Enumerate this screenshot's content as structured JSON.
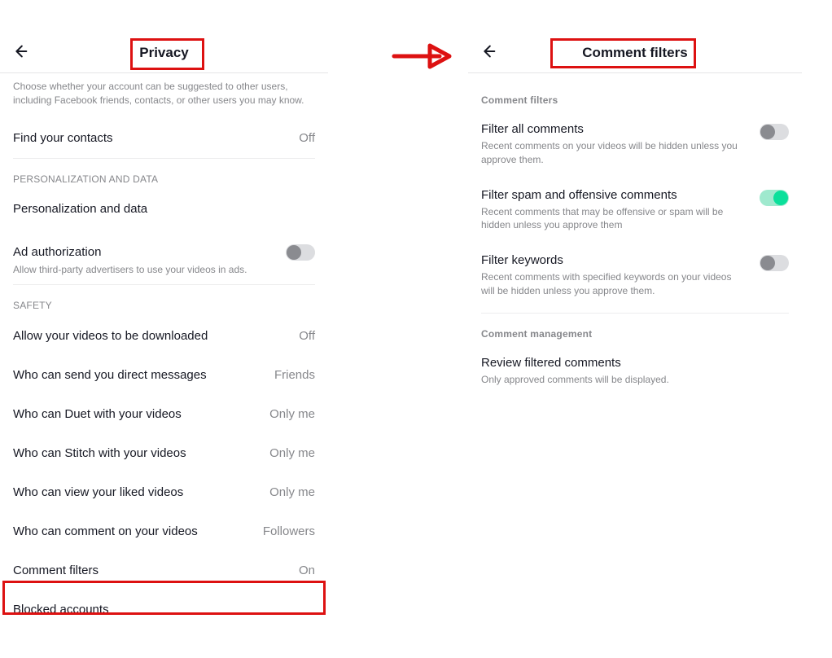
{
  "left": {
    "title": "Privacy",
    "helper": "Choose whether your account can be suggested to other users, including Facebook friends, contacts, or other users you may know.",
    "find_contacts": {
      "label": "Find your contacts",
      "value": "Off"
    },
    "section_personalization": "PERSONALIZATION AND DATA",
    "personalization": {
      "label": "Personalization and data"
    },
    "ad_auth": {
      "label": "Ad authorization",
      "desc": "Allow third-party advertisers to use your videos in ads."
    },
    "section_safety": "SAFETY",
    "safety": [
      {
        "label": "Allow your videos to be downloaded",
        "value": "Off"
      },
      {
        "label": "Who can send you direct messages",
        "value": "Friends"
      },
      {
        "label": "Who can Duet with your videos",
        "value": "Only me"
      },
      {
        "label": "Who can Stitch with your videos",
        "value": "Only me"
      },
      {
        "label": "Who can view your liked videos",
        "value": "Only me"
      },
      {
        "label": "Who can comment on your videos",
        "value": "Followers"
      },
      {
        "label": "Comment filters",
        "value": "On"
      },
      {
        "label": "Blocked accounts",
        "value": ""
      }
    ]
  },
  "right": {
    "title": "Comment filters",
    "section_filters": "Comment filters",
    "filters": [
      {
        "title": "Filter all comments",
        "desc": "Recent comments on your videos will be hidden unless you approve them.",
        "on": false
      },
      {
        "title": "Filter spam and offensive comments",
        "desc": "Recent comments that may be offensive or spam will be hidden unless you approve them",
        "on": true
      },
      {
        "title": "Filter keywords",
        "desc": "Recent comments with specified keywords on your videos will be hidden unless you approve them.",
        "on": false
      }
    ],
    "section_mgmt": "Comment management",
    "review": {
      "title": "Review filtered comments",
      "desc": "Only approved comments will be displayed."
    }
  }
}
